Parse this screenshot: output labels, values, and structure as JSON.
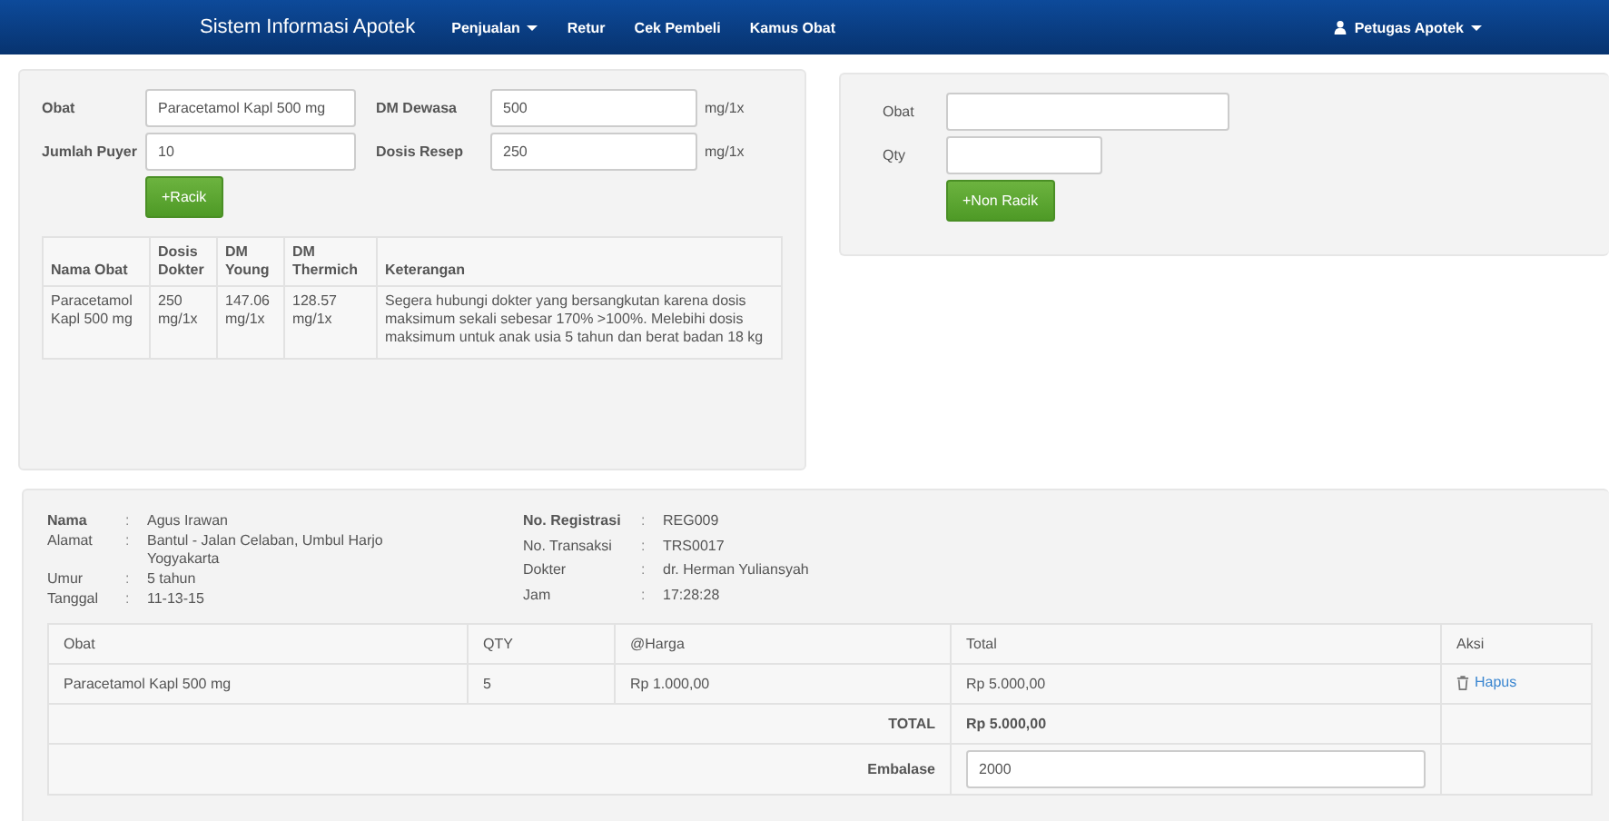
{
  "navbar": {
    "brand": "Sistem Informasi Apotek",
    "menu": [
      {
        "label": "Penjualan",
        "dropdown": true
      },
      {
        "label": "Retur",
        "dropdown": false
      },
      {
        "label": "Cek Pembeli",
        "dropdown": false
      },
      {
        "label": "Kamus Obat",
        "dropdown": false
      }
    ],
    "user": "Petugas Apotek"
  },
  "racik": {
    "fields": [
      {
        "label": "Obat",
        "value": "Paracetamol Kapl 500 mg"
      },
      {
        "label": "DM Dewasa",
        "value": "500",
        "unit": "mg/1x"
      },
      {
        "label": "Jumlah Puyer",
        "value": "10"
      },
      {
        "label": "Dosis Resep",
        "value": "250",
        "unit": "mg/1x"
      }
    ],
    "button": "+Racik",
    "table": {
      "columns": [
        "Nama Obat",
        "Dosis Dokter",
        "DM Young",
        "DM Thermich",
        "Keterangan"
      ],
      "rows": [
        [
          "Paracetamol Kapl 500 mg",
          "250 mg/1x",
          "147.06 mg/1x",
          "128.57 mg/1x",
          "Segera hubungi dokter yang bersangkutan karena dosis maksimum sekali sebesar 170% >100%. Melebihi dosis maksimum untuk anak usia 5 tahun dan berat badan 18 kg"
        ]
      ]
    }
  },
  "non_racik": {
    "fields": [
      {
        "label": "Obat"
      },
      {
        "label": "Qty"
      }
    ],
    "button": "+Non Racik"
  },
  "info_left": [
    {
      "label": "Nama",
      "separator": ":",
      "value": "Agus Irawan",
      "bold": true
    },
    {
      "label": "Alamat",
      "separator": ":",
      "value": "Bantul - Jalan Celaban, Umbul Harjo Yogyakarta",
      "bold": false
    },
    {
      "label": "Umur",
      "separator": ":",
      "value": "5 tahun",
      "bold": false
    },
    {
      "label": "Tanggal",
      "separator": ":",
      "value": "11-13-15",
      "bold": false
    }
  ],
  "info_right": [
    {
      "label": "No. Registrasi",
      "separator": ":",
      "value": "REG009",
      "bold": true
    },
    {
      "label": "No. Transaksi",
      "separator": ":",
      "value": "TRS0017",
      "bold": false
    },
    {
      "label": "Dokter",
      "separator": ":",
      "value": "dr. Herman Yuliansyah",
      "bold": false
    },
    {
      "label": "Jam",
      "separator": ":",
      "value": "17:28:28",
      "bold": false
    }
  ],
  "cart": {
    "columns": [
      "Obat",
      "QTY",
      "@Harga",
      "Total",
      "Aksi"
    ],
    "rows": [
      {
        "obat": "Paracetamol Kapl 500 mg",
        "qty": "5",
        "harga": "Rp 1.000,00",
        "total": "Rp 5.000,00",
        "action": "Hapus"
      }
    ],
    "total_label": "TOTAL",
    "total_value": "Rp 5.000,00",
    "embalase_label": "Embalase",
    "embalase_value": "2000"
  }
}
